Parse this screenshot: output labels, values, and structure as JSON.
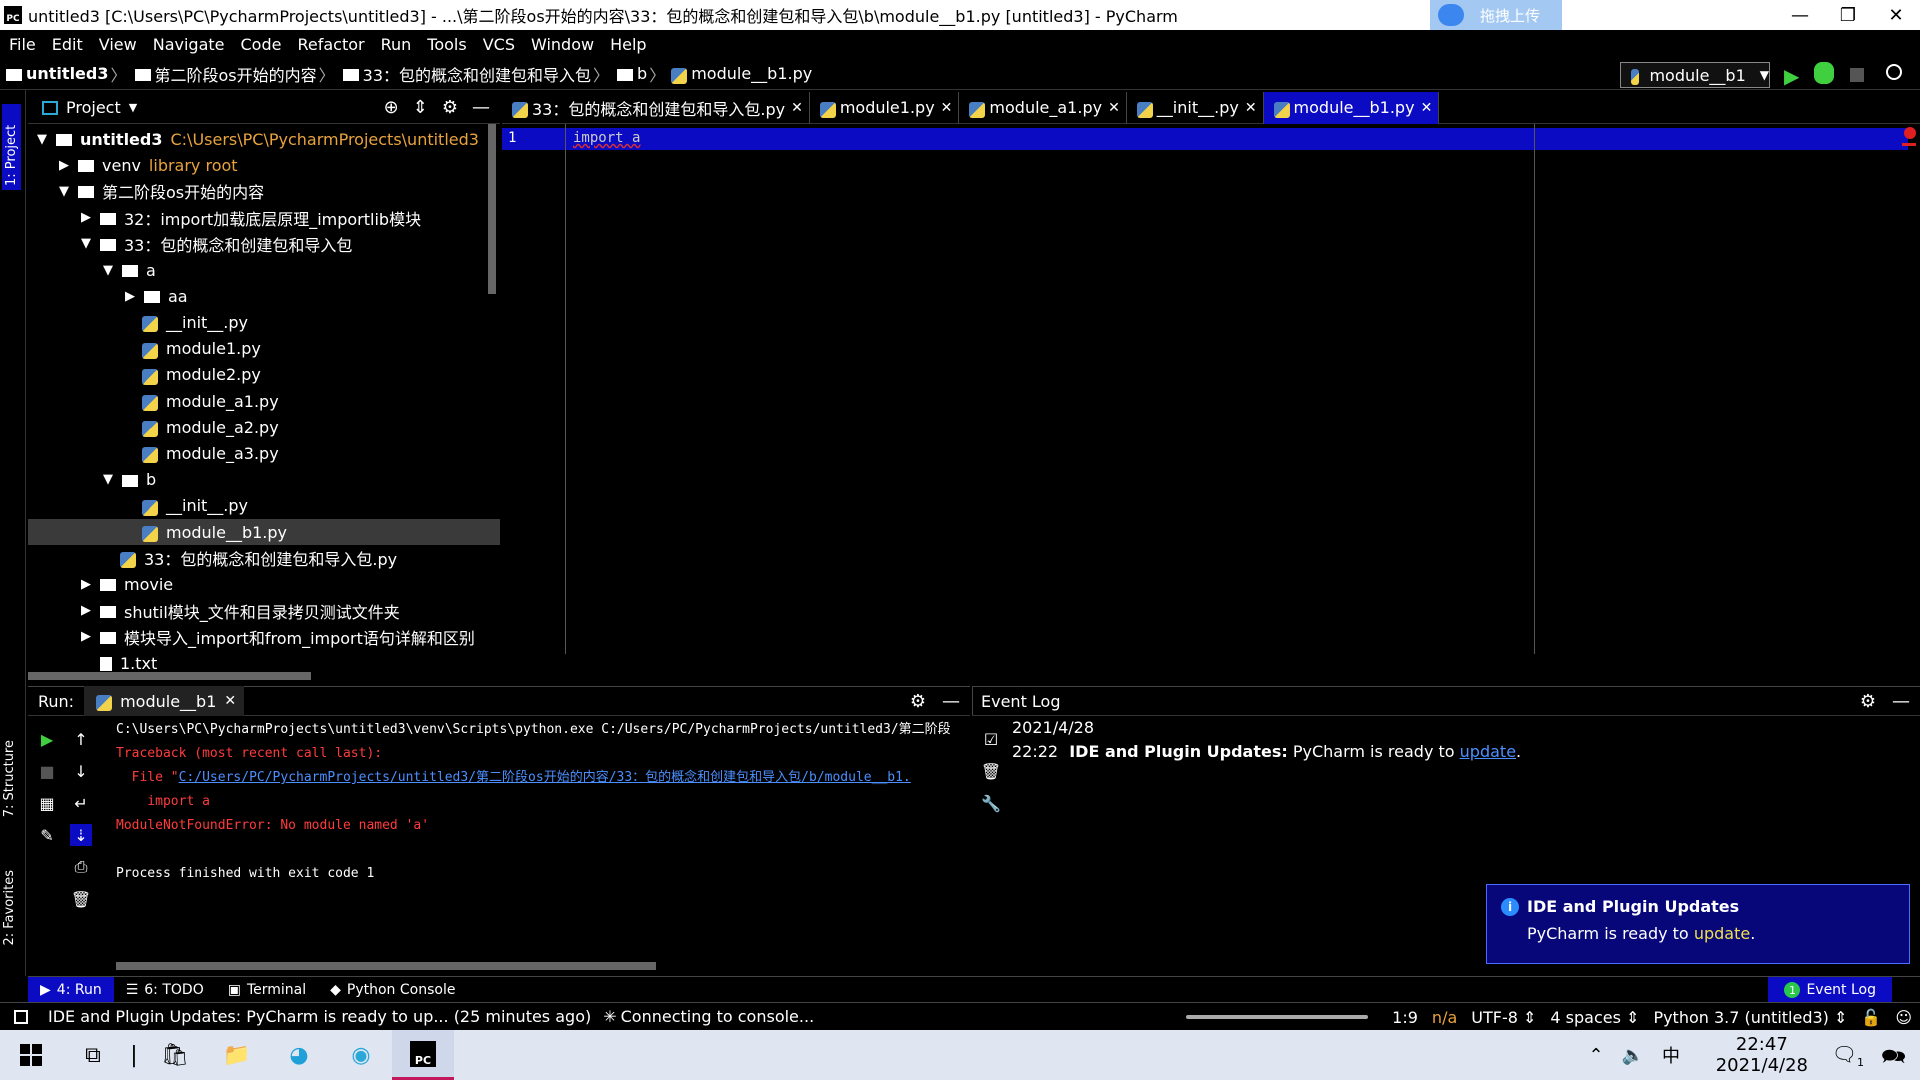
{
  "window": {
    "title": "untitled3 [C:\\Users\\PC\\PycharmProjects\\untitled3] - ...\\第二阶段os开始的内容\\33：包的概念和创建包和导入包\\b\\module__b1.py [untitled3] - PyCharm",
    "app_icon": "PC",
    "upload_badge": "拖拽上传"
  },
  "menu": [
    "File",
    "Edit",
    "View",
    "Navigate",
    "Code",
    "Refactor",
    "Run",
    "Tools",
    "VCS",
    "Window",
    "Help"
  ],
  "breadcrumb": [
    "untitled3",
    "第二阶段os开始的内容",
    "33：包的概念和创建包和导入包",
    "b",
    "module__b1.py"
  ],
  "run_config": "module__b1",
  "left_strip": {
    "project": "1: Project",
    "structure": "7: Structure",
    "favorites": "2: Favorites"
  },
  "project_panel": {
    "title": "Project"
  },
  "tree": [
    {
      "label": "untitled3",
      "extra": "C:\\Users\\PC\\PycharmProjects\\untitled3",
      "depth": 0,
      "arrow": "▼",
      "type": "folder"
    },
    {
      "label": "venv",
      "extra": "library root",
      "depth": 1,
      "arrow": "▶",
      "type": "folder"
    },
    {
      "label": "第二阶段os开始的内容",
      "extra": "",
      "depth": 1,
      "arrow": "▼",
      "type": "folder"
    },
    {
      "label": "32：import加载底层原理_importlib模块",
      "extra": "",
      "depth": 2,
      "arrow": "▶",
      "type": "folder"
    },
    {
      "label": "33：包的概念和创建包和导入包",
      "extra": "",
      "depth": 2,
      "arrow": "▼",
      "type": "folder"
    },
    {
      "label": "a",
      "extra": "",
      "depth": 3,
      "arrow": "▼",
      "type": "folder"
    },
    {
      "label": "aa",
      "extra": "",
      "depth": 4,
      "arrow": "▶",
      "type": "folder"
    },
    {
      "label": "__init__.py",
      "extra": "",
      "depth": 4,
      "arrow": "",
      "type": "py"
    },
    {
      "label": "module1.py",
      "extra": "",
      "depth": 4,
      "arrow": "",
      "type": "py"
    },
    {
      "label": "module2.py",
      "extra": "",
      "depth": 4,
      "arrow": "",
      "type": "py"
    },
    {
      "label": "module_a1.py",
      "extra": "",
      "depth": 4,
      "arrow": "",
      "type": "py"
    },
    {
      "label": "module_a2.py",
      "extra": "",
      "depth": 4,
      "arrow": "",
      "type": "py"
    },
    {
      "label": "module_a3.py",
      "extra": "",
      "depth": 4,
      "arrow": "",
      "type": "py"
    },
    {
      "label": "b",
      "extra": "",
      "depth": 3,
      "arrow": "▼",
      "type": "folder"
    },
    {
      "label": "__init__.py",
      "extra": "",
      "depth": 4,
      "arrow": "",
      "type": "py"
    },
    {
      "label": "module__b1.py",
      "extra": "",
      "depth": 4,
      "arrow": "",
      "type": "py",
      "selected": true
    },
    {
      "label": "33：包的概念和创建包和导入包.py",
      "extra": "",
      "depth": 3,
      "arrow": "",
      "type": "py"
    },
    {
      "label": "movie",
      "extra": "",
      "depth": 2,
      "arrow": "▶",
      "type": "folder"
    },
    {
      "label": "shutil模块_文件和目录拷贝测试文件夹",
      "extra": "",
      "depth": 2,
      "arrow": "▶",
      "type": "folder"
    },
    {
      "label": "模块导入_import和from_import语句详解和区别",
      "extra": "",
      "depth": 2,
      "arrow": "▶",
      "type": "folder"
    },
    {
      "label": "1.txt",
      "extra": "",
      "depth": 2,
      "arrow": "",
      "type": "txt"
    }
  ],
  "editor_tabs": [
    {
      "label": "33：包的概念和创建包和导入包.py",
      "active": false
    },
    {
      "label": "module1.py",
      "active": false
    },
    {
      "label": "module_a1.py",
      "active": false
    },
    {
      "label": "__init__.py",
      "active": false
    },
    {
      "label": "module__b1.py",
      "active": true
    }
  ],
  "editor": {
    "line_number": "1",
    "code": "import a"
  },
  "run_panel": {
    "label": "Run:",
    "tab": "module__b1",
    "console": [
      {
        "text": "C:\\Users\\PC\\PycharmProjects\\untitled3\\venv\\Scripts\\python.exe C:/Users/PC/PycharmProjects/untitled3/第二阶段",
        "cls": ""
      },
      {
        "text": "Traceback (most recent call last):",
        "cls": "err"
      },
      {
        "text": "  File \"",
        "cls": "err",
        "link": "C:/Users/PC/PycharmProjects/untitled3/第二阶段os开始的内容/33：包的概念和创建包和导入包/b/module__b1."
      },
      {
        "text": "    import a",
        "cls": "err"
      },
      {
        "text": "ModuleNotFoundError: No module named 'a'",
        "cls": "err"
      },
      {
        "text": "",
        "cls": ""
      },
      {
        "text": "Process finished with exit code 1",
        "cls": ""
      }
    ]
  },
  "event_log": {
    "title": "Event Log",
    "date": "2021/4/28",
    "time": "22:22",
    "bold": "IDE and Plugin Updates:",
    "text": " PyCharm is ready to ",
    "link": "update",
    "tail": "."
  },
  "notification": {
    "title": "IDE and Plugin Updates",
    "text": "PyCharm is ready to ",
    "link": "update",
    "tail": "."
  },
  "tool_windows": [
    {
      "label": "4: Run",
      "active": true,
      "icon": "play-icon"
    },
    {
      "label": "6: TODO",
      "active": false,
      "icon": "list-icon"
    },
    {
      "label": "Terminal",
      "active": false,
      "icon": "terminal-icon"
    },
    {
      "label": "Python Console",
      "active": false,
      "icon": "python-icon"
    }
  ],
  "event_log_button": "Event Log",
  "event_log_count": "1",
  "status": {
    "message": "IDE and Plugin Updates: PyCharm is ready to up... (25 minutes ago)",
    "connecting": "Connecting to console...",
    "position": "1:9",
    "na": "n/a",
    "encoding": "UTF-8 ⇕",
    "indent": "4 spaces ⇕",
    "interpreter": "Python 3.7 (untitled3) ⇕"
  },
  "taskbar": {
    "time": "22:47",
    "date": "2021/4/28",
    "ime": "中",
    "notif_count": "1"
  }
}
